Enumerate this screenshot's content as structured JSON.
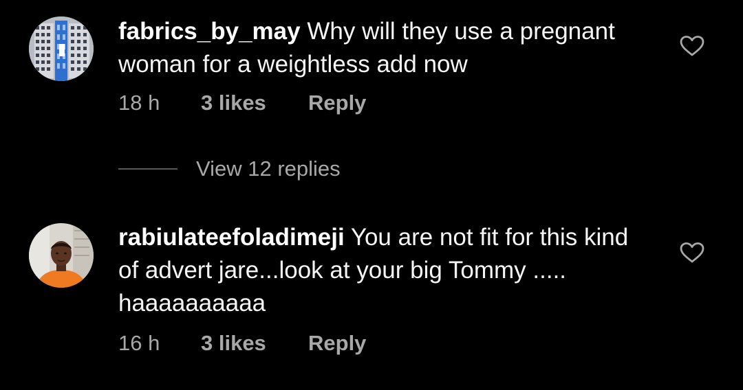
{
  "comments": [
    {
      "username": "fabrics_by_may",
      "text": "Why will they use a pregnant woman for a weightless add now",
      "time": "18 h",
      "likes": "3 likes",
      "reply": "Reply",
      "avatar_icon": "building-avatar",
      "like_icon": "heart-outline-icon"
    },
    {
      "username": "rabiulateefoladimeji",
      "text": "You are not fit for this kind of advert jare...look at your big Tommy ..... haaaaaaaaaa",
      "time": "16 h",
      "likes": "3 likes",
      "reply": "Reply",
      "avatar_icon": "person-avatar",
      "like_icon": "heart-outline-icon"
    }
  ],
  "view_replies": "View 12 replies",
  "colors": {
    "background": "#000000",
    "primary_text": "#f5f5f5",
    "secondary_text": "#a8a8a8",
    "divider": "#5a5a5a"
  }
}
